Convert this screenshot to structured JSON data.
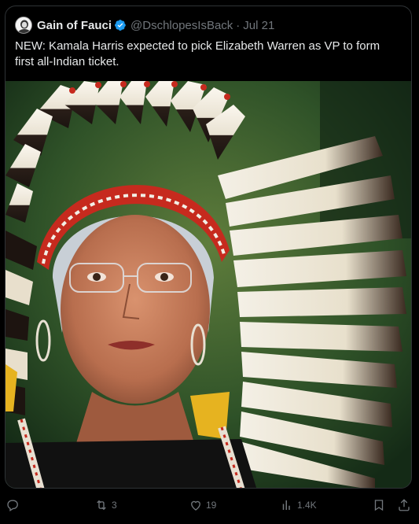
{
  "post": {
    "author_name": "Gain of Fauci",
    "handle": "@DschlopesIsBack",
    "separator": "·",
    "date": "Jul 21",
    "text": "NEW: Kamala Harris expected to pick Elizabeth Warren as VP to form first all-Indian ticket."
  },
  "actions": {
    "reposts": "3",
    "likes": "19",
    "views": "1.4K"
  },
  "colors": {
    "background": "#000000",
    "text": "#e7e9ea",
    "muted": "#71767b",
    "verified": "#1d9bf0",
    "border": "#2f3336"
  },
  "icons": [
    "reply-icon",
    "repost-icon",
    "like-icon",
    "views-icon",
    "bookmark-icon",
    "share-icon",
    "verified-badge-icon"
  ]
}
